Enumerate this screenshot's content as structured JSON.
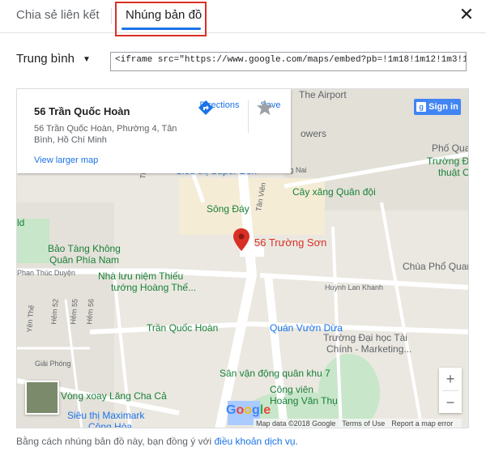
{
  "tabs": {
    "share_label": "Chia sẻ liên kết",
    "embed_label": "Nhúng bản đồ"
  },
  "close_glyph": "✕",
  "size_select": {
    "selected": "Trung bình",
    "caret": "▼"
  },
  "embed_code": "<iframe src=\"https://www.google.com/maps/embed?pb=!1m18!1m12!1m3!1d39",
  "map": {
    "info_card": {
      "title": "56 Trần Quốc Hoàn",
      "address": "56 Trần Quốc Hoàn, Phường 4, Tân Bình, Hồ Chí Minh",
      "view_larger": "View larger map",
      "directions": "Directions",
      "save": "Save"
    },
    "sign_in": "Sign in",
    "pin_label": "56 Trường Sơn",
    "zoom_in": "+",
    "zoom_out": "−",
    "attribution": {
      "map_data": "Map data ©2018 Google",
      "terms": "Terms of Use",
      "report": "Report a map error"
    },
    "labels": {
      "airport": "The Airport",
      "towers": "owers",
      "pho_quang": "Phố Quang",
      "truong_dai": "Trường Đạ",
      "thuat": "thuật C",
      "super": "Siêu thị Super Bon",
      "dong_nai": "Đông Nai",
      "cay_xang": "Cây xăng Quân đội",
      "song_day": "Sông Đáy",
      "thang_long": "Thăng Long",
      "tan_vien": "Tân Viên",
      "bao_tang_1": "Bảo Tàng Không",
      "bao_tang_2": "Quân Phía Nam",
      "phan_thuc_duyen": "Phan Thúc Duyện",
      "nha_luu_niem_1": "Nhà lưu niệm Thiếu",
      "nha_luu_niem_2": "tướng Hoàng Thế...",
      "chua_pho_quang": "Chùa Phổ Quan",
      "huynh_lan_khanh": "Huỳnh Lan Khanh",
      "tran_quoc_hoan": "Trần Quốc Hoàn",
      "quan_vuon_dua": "Quán Vườn Dừa",
      "truong_dai_hoc_1": "Trường Đại học Tài",
      "truong_dai_hoc_2": "Chính - Marketing...",
      "giai_phong": "Giải Phóng",
      "san_van_dong": "Sân vận động quân khu 7",
      "vong_xoay": "Vòng xoay Lăng Cha Cả",
      "cong_vien_1": "Công viên",
      "cong_vien_2": "Hoàng Văn Thụ",
      "maximark_1": "Siêu thị Maximark",
      "maximark_2": "Cộng Hòa",
      "hem_52": "Hẻm 52",
      "hem_55": "Hẻm 55",
      "hem_56": "Hẻm 56",
      "yen_the": "Yên Thế",
      "left_d": "ld"
    }
  },
  "footer": {
    "text": "Bằng cách nhúng bản đồ này, bạn đồng ý với ",
    "link": "điều khoản dịch vụ",
    "end": "."
  },
  "colors": {
    "accent": "#1a73e8",
    "highlight": "#d93025",
    "park": "#c8e6c9",
    "road": "#ffffff"
  }
}
